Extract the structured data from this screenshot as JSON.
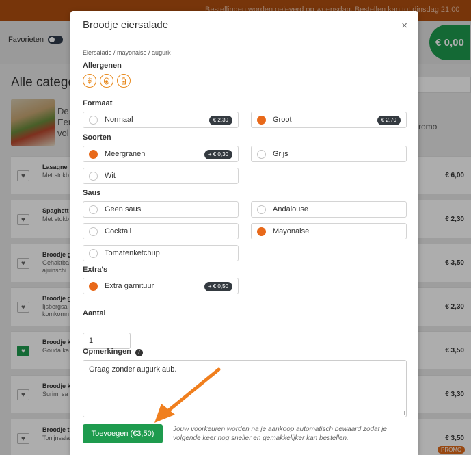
{
  "topbar": {
    "notice": "Bestellingen worden geleverd op woensdag. Bestellen kan tot dinsdag 21:00"
  },
  "subbar": {
    "favorites_label": "Favorieten",
    "cart_total": "€ 0,00"
  },
  "categories": {
    "heading": "Alle catego",
    "item_title": "De",
    "item_text_1": "Een",
    "item_text_2": "vol",
    "promo_label": "romo"
  },
  "products": [
    {
      "name": "Lasagne",
      "desc": "Met stokb",
      "price": "€ 6,00",
      "favorite": false
    },
    {
      "name": "Spaghett",
      "desc": "Met stokb",
      "price": "€ 2,30",
      "favorite": false
    },
    {
      "name": "Broodje g",
      "desc": "Gehaktba ajuinschi",
      "price": "€ 3,50",
      "favorite": false
    },
    {
      "name": "Broodje g",
      "desc": "Ijsbergsal komkomn",
      "price": "€ 2,30",
      "favorite": false
    },
    {
      "name": "Broodje k",
      "desc": "Gouda ka",
      "price": "€ 3,50",
      "favorite": true
    },
    {
      "name": "Broodje k",
      "desc": "Surimi sa",
      "price": "€ 3,30",
      "favorite": false
    },
    {
      "name": "Broodje t",
      "desc": "Tonijnsalade",
      "price": "€ 3,50",
      "favorite": false
    }
  ],
  "promo_badge": "PROMO",
  "modal": {
    "title": "Broodje eiersalade",
    "close": "×",
    "ingredients": "Eiersalade / mayonaise / augurk",
    "allergens_heading": "Allergenen",
    "allergens": [
      "wheat-icon",
      "egg-icon",
      "mustard-icon"
    ],
    "format_heading": "Formaat",
    "format_options": [
      {
        "label": "Normaal",
        "badge": "€ 2,30",
        "checked": false
      },
      {
        "label": "Groot",
        "badge": "€ 2,70",
        "checked": true
      }
    ],
    "types_heading": "Soorten",
    "type_options": [
      {
        "label": "Meergranen",
        "badge": "+ € 0,30",
        "checked": true
      },
      {
        "label": "Grijs",
        "badge": "",
        "checked": false
      },
      {
        "label": "Wit",
        "badge": "",
        "checked": false
      }
    ],
    "sauce_heading": "Saus",
    "sauce_options": [
      {
        "label": "Geen saus",
        "checked": false
      },
      {
        "label": "Andalouse",
        "checked": false
      },
      {
        "label": "Cocktail",
        "checked": false
      },
      {
        "label": "Mayonaise",
        "checked": true
      },
      {
        "label": "Tomatenketchup",
        "checked": false
      }
    ],
    "extras_heading": "Extra's",
    "extra_options": [
      {
        "label": "Extra garnituur",
        "badge": "+ € 0,50",
        "checked": true
      }
    ],
    "quantity_heading": "Aantal",
    "quantity_value": "1",
    "remarks_heading": "Opmerkingen",
    "remarks_value": "Graag zonder augurk aub.",
    "add_button": "Toevoegen (€3,50)",
    "save_note": "Jouw voorkeuren worden na je aankoop automatisch bewaard zodat je volgende keer nog sneller en gemakkelijker kan bestellen."
  },
  "colors": {
    "accent": "#e8691a",
    "green": "#1e9b4e",
    "topbar": "#b04e10",
    "badge": "#343a40"
  }
}
